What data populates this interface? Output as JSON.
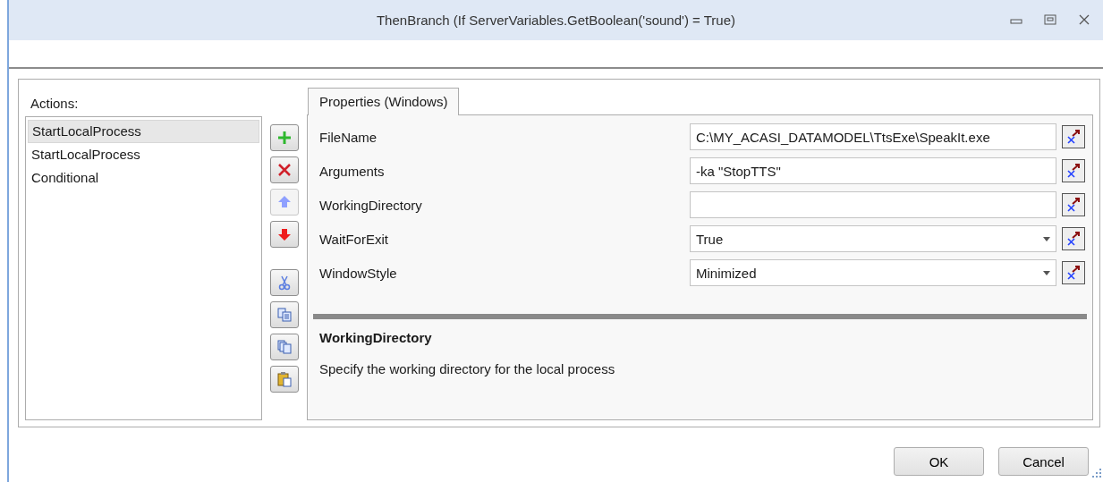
{
  "window": {
    "title": "ThenBranch (If ServerVariables.GetBoolean('sound') = True)"
  },
  "actions": {
    "label": "Actions:",
    "items": [
      {
        "text": "StartLocalProcess",
        "selected": true
      },
      {
        "text": "StartLocalProcess",
        "selected": false
      },
      {
        "text": "Conditional",
        "selected": false
      }
    ]
  },
  "toolbar": [
    {
      "kind": "add",
      "disabled": false
    },
    {
      "kind": "delete",
      "disabled": false
    },
    {
      "kind": "up",
      "disabled": true
    },
    {
      "kind": "down",
      "disabled": false
    },
    {
      "kind": "cut",
      "disabled": false
    },
    {
      "kind": "copy",
      "disabled": false
    },
    {
      "kind": "duplicate",
      "disabled": false
    },
    {
      "kind": "paste",
      "disabled": false
    }
  ],
  "tabs": [
    {
      "label": "Properties (Windows)",
      "selected": true
    }
  ],
  "properties": [
    {
      "name": "FileName",
      "kind": "text",
      "value": "C:\\MY_ACASI_DATAMODEL\\TtsExe\\SpeakIt.exe"
    },
    {
      "name": "Arguments",
      "kind": "text",
      "value": "-ka \"StopTTS\""
    },
    {
      "name": "WorkingDirectory",
      "kind": "text"
    },
    {
      "name": "WaitForExit",
      "kind": "dropdown",
      "value": "True"
    },
    {
      "name": "WindowStyle",
      "kind": "dropdown",
      "value": "Minimized"
    }
  ],
  "description": {
    "title": "WorkingDirectory",
    "text": "Specify the working directory for the local process"
  },
  "buttons": [
    "OK",
    "Cancel"
  ]
}
